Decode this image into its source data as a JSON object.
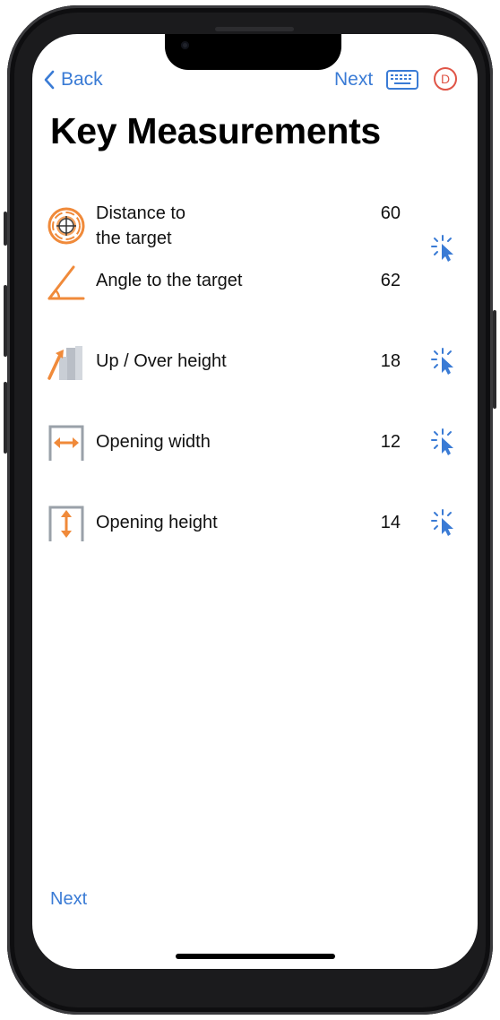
{
  "colors": {
    "accent": "#3a7bd5",
    "icon_orange": "#f08a3a",
    "avatar_red": "#e05547"
  },
  "nav": {
    "back_label": "Back",
    "next_label": "Next",
    "keyboard_icon": "keyboard-icon",
    "avatar_letter": "D"
  },
  "page_title": "Key Measurements",
  "measurements": [
    {
      "label_line1": "Distance to",
      "label_line2": "the target",
      "value": "60",
      "icon": "target-icon"
    },
    {
      "label": "Angle to the target",
      "value": "62",
      "icon": "angle-icon"
    },
    {
      "label": "Up / Over height",
      "value": "18",
      "icon": "up-over-icon"
    },
    {
      "label": "Opening width",
      "value": "12",
      "icon": "opening-width-icon"
    },
    {
      "label": "Opening height",
      "value": "14",
      "icon": "opening-height-icon"
    }
  ],
  "footer": {
    "next_label": "Next"
  }
}
